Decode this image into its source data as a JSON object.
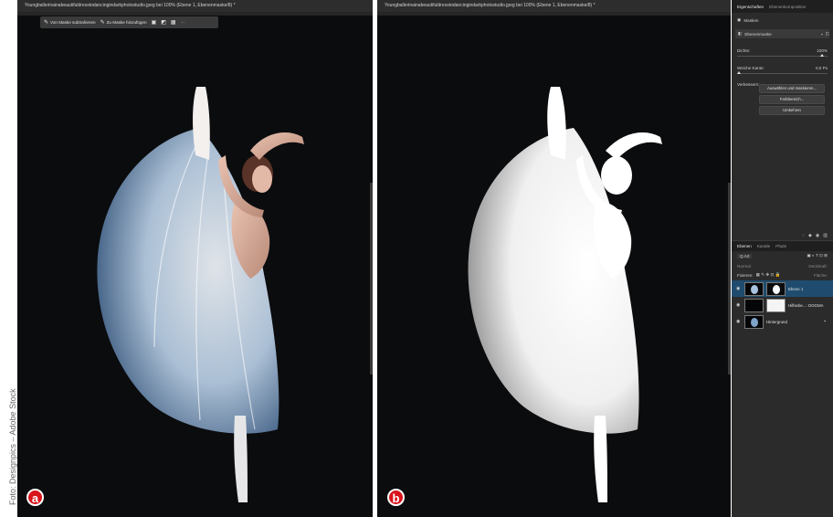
{
  "credit": "Foto: Designpics – Adobe Stock",
  "pane_a": {
    "tab_title": "Youngballerinainabeautifuldresstodancingindarkphotostudio.jpeg bei 100% (Ebene 1, Ebenenmaske/8) *",
    "toolbar": {
      "subtract_label": "Von Maske subtrahieren",
      "add_label": "Zu Maske hinzufügen",
      "more_label": "···"
    },
    "badge": "a"
  },
  "pane_b": {
    "tab_title": "Youngballerinainabeautifuldresstodancingindarkphotostudio.jpeg bei 100% (Ebene 1, Ebenenmaske/8) *",
    "badge": "b"
  },
  "properties": {
    "tabs": [
      "Eigenschaften",
      "Ebenenkomposition"
    ],
    "section_label": "Masken",
    "mask_type": "Ebenenmaske",
    "density_label": "Dichte:",
    "density_value": "100%",
    "feather_label": "Weiche Kante:",
    "feather_value": "0,0 Px",
    "refine_label": "Verbessern:",
    "buttons": [
      "Auswählen und maskieren...",
      "Farbbereich...",
      "Umkehren"
    ]
  },
  "layers_panel": {
    "tabs": [
      "Ebenen",
      "Kanäle",
      "Pfade"
    ],
    "filter_label": "Q Art",
    "blend_mode": "Normal",
    "opacity_label": "Deckkraft:",
    "lock_label": "Fixieren:",
    "fill_label": "Fläche:",
    "layers": [
      {
        "name": "Ebene 1",
        "selected": true
      },
      {
        "name": "Hilfsebe...: DOGMA",
        "selected": false
      },
      {
        "name": "Hintergrund",
        "selected": false
      }
    ]
  },
  "colors": {
    "badge": "#d9141b",
    "selection": "#1f4c6e",
    "canvas": "#0b0c0e"
  }
}
